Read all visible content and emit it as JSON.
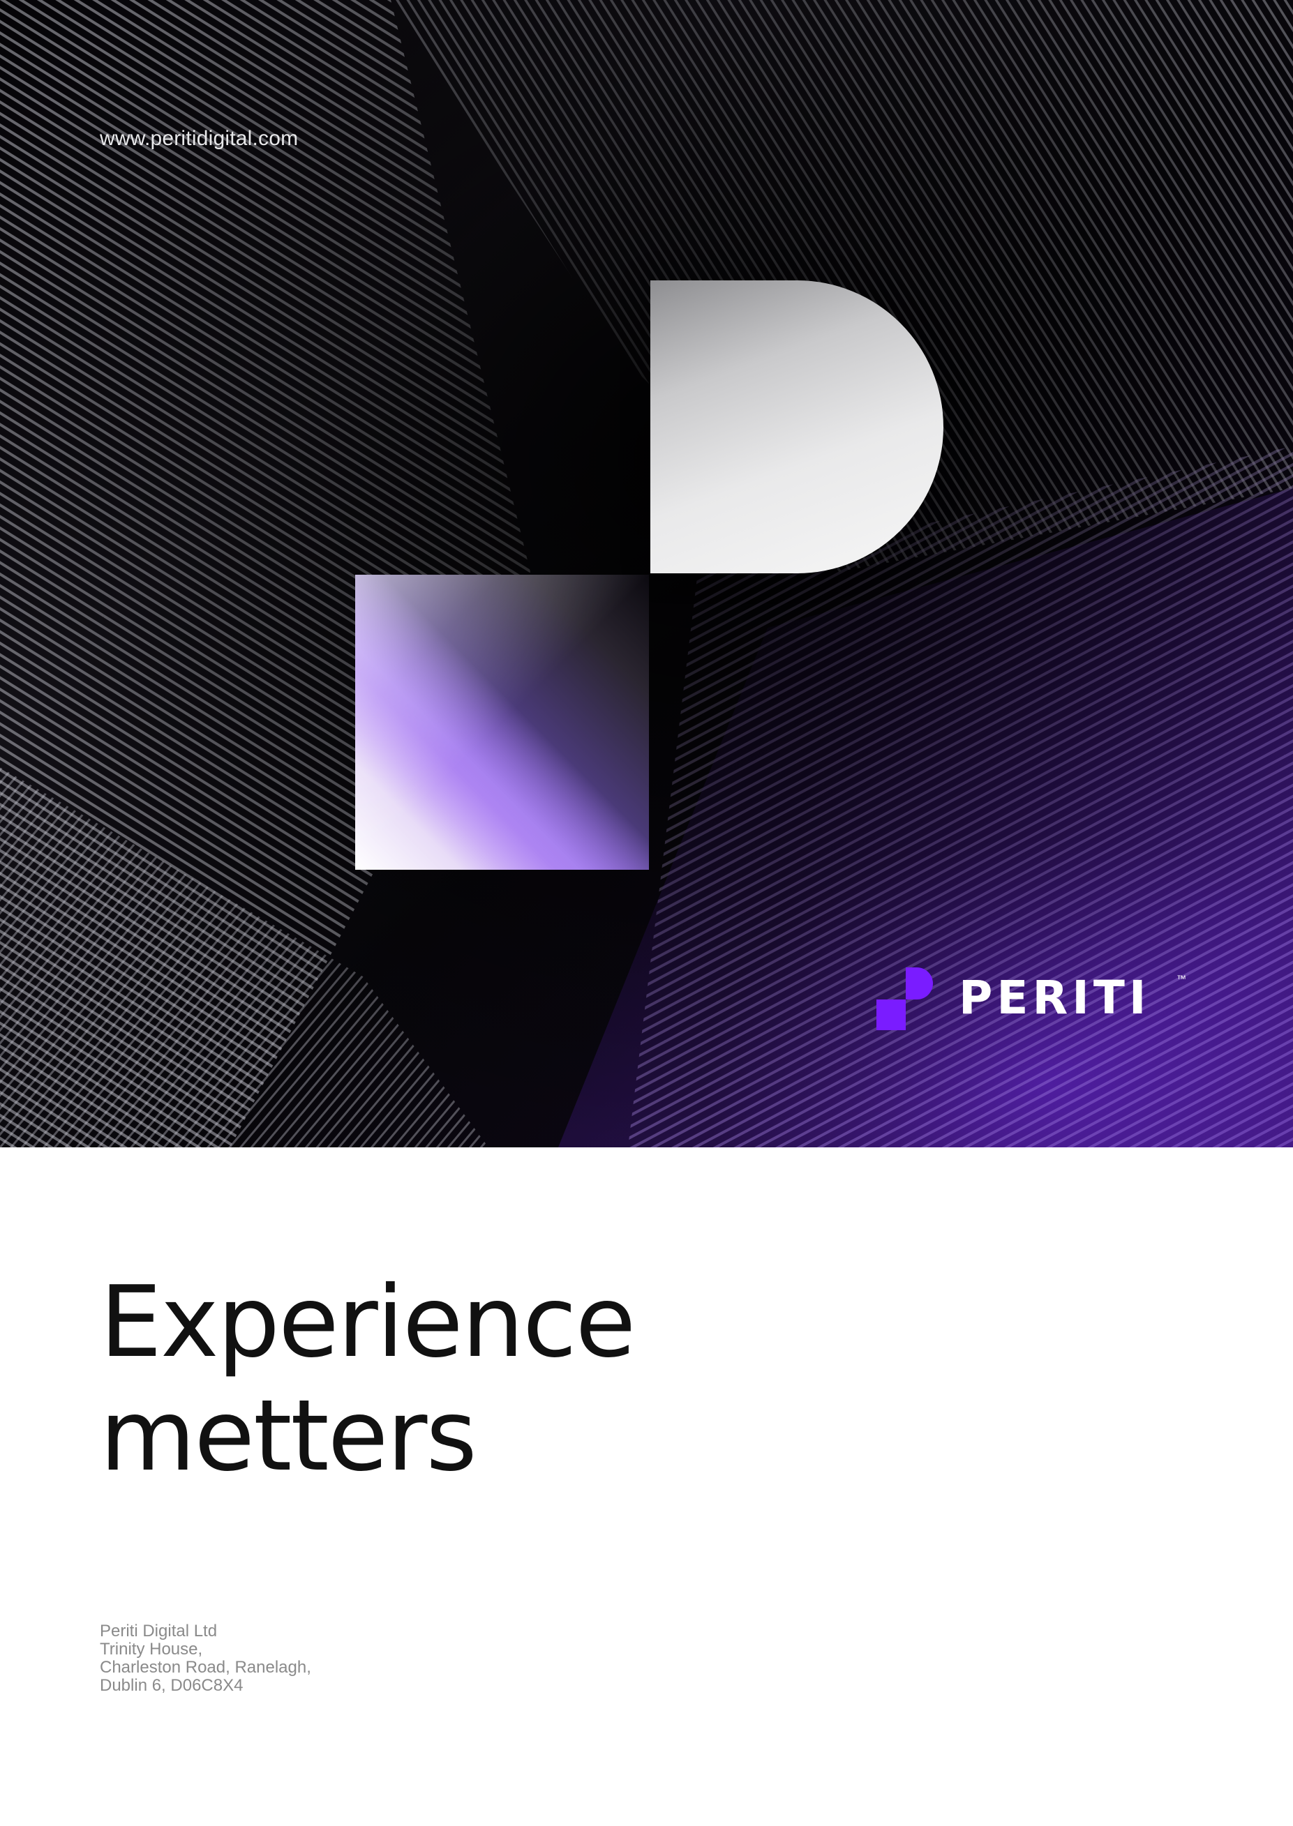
{
  "header": {
    "website": "www.peritidigital.com"
  },
  "logo": {
    "wordmark": "PERITI",
    "trademark": "™",
    "accent_color": "#6a14ff"
  },
  "headline": {
    "line1": "Experience",
    "line2": "metters"
  },
  "address": {
    "company": "Periti Digital Ltd",
    "line1": "Trinity House,",
    "line2": "Charleston Road, Ranelagh,",
    "line3": "Dublin 6, D06C8X4"
  },
  "colors": {
    "hero_background": "#08070b",
    "page_background": "#ffffff",
    "headline_text": "#111111",
    "address_text": "#8a8a8a",
    "brand_purple": "#7a1cff"
  }
}
